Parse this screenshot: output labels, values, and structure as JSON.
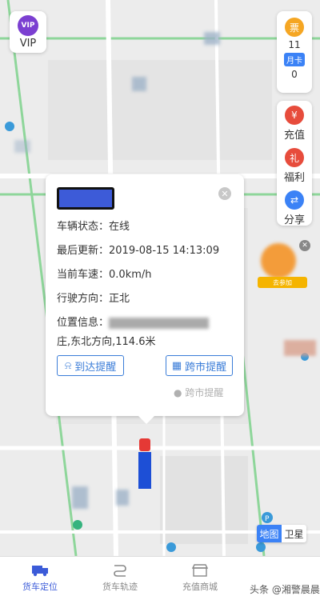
{
  "vip": {
    "label": "VIP",
    "badge": "VIP"
  },
  "ticket": {
    "icon_char": "票",
    "count": "11"
  },
  "monthly_card": {
    "label": "月卡",
    "count": "0"
  },
  "side_menu": [
    {
      "label": "充值",
      "icon": "yen-icon",
      "char": "¥",
      "color": "#e74c3c"
    },
    {
      "label": "福利",
      "icon": "gift-icon",
      "char": "礼",
      "color": "#e74c3c"
    },
    {
      "label": "分享",
      "icon": "share-icon",
      "char": "⇄",
      "color": "#3b82f6"
    }
  ],
  "vehicle": {
    "status_label": "车辆状态：",
    "status": "在线",
    "last_update_label": "最后更新：",
    "last_update": "2019-08-15 14:13:09",
    "speed_label": "当前车速：",
    "speed": "0.0km/h",
    "direction_label": "行驶方向：",
    "direction": "正北",
    "location_label": "位置信息：",
    "location_tail": "庄,东北方向,114.6米"
  },
  "popup": {
    "arrive_button": "到达提醒",
    "cross_city_button": "跨市提醒",
    "hint": "跨市提醒"
  },
  "map_switch": {
    "map": "地图",
    "satellite": "卫星"
  },
  "tabs": [
    {
      "label": "货车定位",
      "icon": "truck-icon",
      "active": true
    },
    {
      "label": "货车轨迹",
      "icon": "route-icon",
      "active": false
    },
    {
      "label": "充值商城",
      "icon": "store-icon",
      "active": false
    }
  ],
  "ad": {
    "tag": "去参加"
  },
  "watermark": "头条 @湘警晨晨",
  "colors": {
    "accent": "#3b5bd8",
    "link": "#3b7dd8",
    "truck": "#1d4fd6"
  }
}
